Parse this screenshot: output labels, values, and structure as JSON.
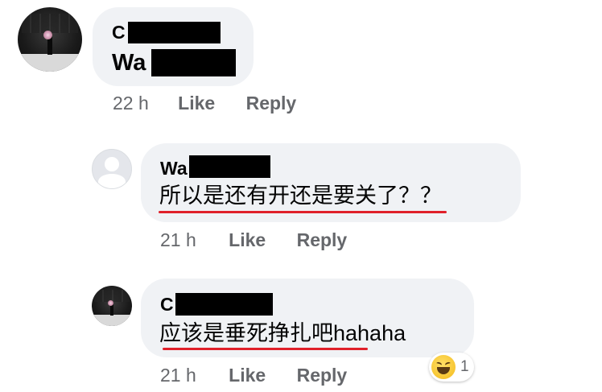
{
  "comments": [
    {
      "name_visible": "C",
      "message_visible": "Wa",
      "time": "22 h",
      "like_label": "Like",
      "reply_label": "Reply"
    }
  ],
  "replies": [
    {
      "name_visible": "Wa",
      "message": "所以是还有开还是要关了？？",
      "time": "21 h",
      "like_label": "Like",
      "reply_label": "Reply"
    },
    {
      "name_visible": "C",
      "message": "应该是垂死挣扎吧hahaha",
      "time": "21 h",
      "like_label": "Like",
      "reply_label": "Reply",
      "reaction": {
        "icon": "laughing-emoji-icon",
        "count": "1"
      }
    }
  ],
  "colors": {
    "bubble": "#f0f2f5",
    "meta_text": "#65676b",
    "underline": "#e0202a",
    "redaction": "#000000"
  }
}
